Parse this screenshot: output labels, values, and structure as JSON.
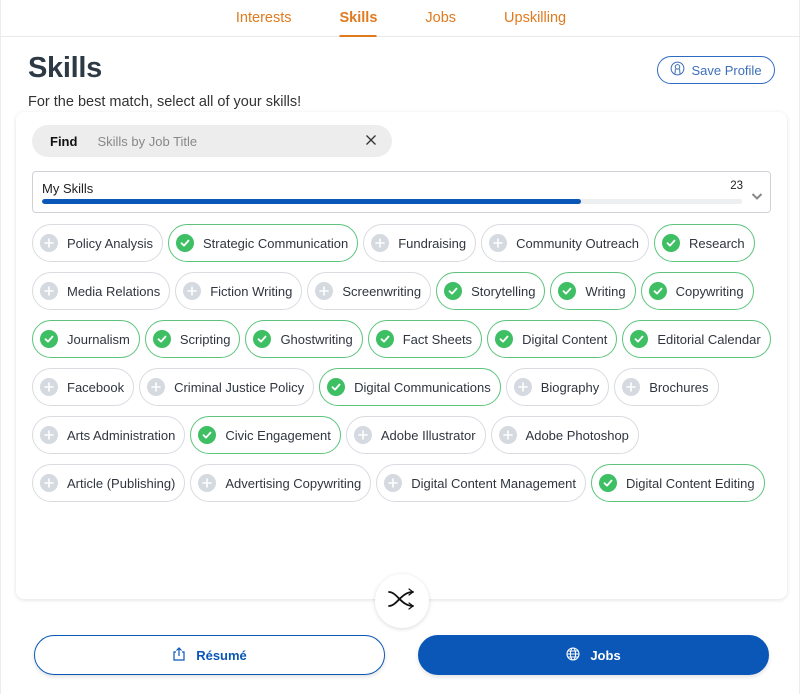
{
  "nav": {
    "tabs": [
      {
        "label": "Interests",
        "active": false
      },
      {
        "label": "Skills",
        "active": true
      },
      {
        "label": "Jobs",
        "active": false
      },
      {
        "label": "Upskilling",
        "active": false
      }
    ]
  },
  "header": {
    "title": "Skills",
    "subtitle": "For the best match, select all of your skills!",
    "save_label": "Save Profile"
  },
  "find": {
    "label": "Find",
    "placeholder": "Skills by Job Title",
    "value": ""
  },
  "my_skills": {
    "label": "My Skills",
    "count": "23",
    "progress_percent": 77
  },
  "skills": [
    {
      "label": "Policy Analysis",
      "selected": false
    },
    {
      "label": "Strategic Communication",
      "selected": true
    },
    {
      "label": "Fundraising",
      "selected": false
    },
    {
      "label": "Community Outreach",
      "selected": false
    },
    {
      "label": "Research",
      "selected": true
    },
    {
      "label": "Media Relations",
      "selected": false
    },
    {
      "label": "Fiction Writing",
      "selected": false
    },
    {
      "label": "Screenwriting",
      "selected": false
    },
    {
      "label": "Storytelling",
      "selected": true
    },
    {
      "label": "Writing",
      "selected": true
    },
    {
      "label": "Copywriting",
      "selected": true
    },
    {
      "label": "Journalism",
      "selected": true
    },
    {
      "label": "Scripting",
      "selected": true
    },
    {
      "label": "Ghostwriting",
      "selected": true
    },
    {
      "label": "Fact Sheets",
      "selected": true
    },
    {
      "label": "Digital Content",
      "selected": true
    },
    {
      "label": "Editorial Calendar",
      "selected": true
    },
    {
      "label": "Facebook",
      "selected": false
    },
    {
      "label": "Criminal Justice Policy",
      "selected": false
    },
    {
      "label": "Digital Communications",
      "selected": true
    },
    {
      "label": "Biography",
      "selected": false
    },
    {
      "label": "Brochures",
      "selected": false
    },
    {
      "label": "Arts Administration",
      "selected": false
    },
    {
      "label": "Civic Engagement",
      "selected": true
    },
    {
      "label": "Adobe Illustrator",
      "selected": false
    },
    {
      "label": "Adobe Photoshop",
      "selected": false
    },
    {
      "label": "Article (Publishing)",
      "selected": false
    },
    {
      "label": "Advertising Copywriting",
      "selected": false
    },
    {
      "label": "Digital Content Management",
      "selected": false
    },
    {
      "label": "Digital Content Editing",
      "selected": true
    }
  ],
  "icons": {
    "save": "user-circle-icon",
    "clear": "close-icon",
    "dropdown": "chevron-down-icon",
    "selected": "check-circle-icon",
    "unselected": "plus-circle-icon",
    "shuffle": "shuffle-icon",
    "resume": "upload-icon",
    "jobs": "globe-icon"
  },
  "footer": {
    "resume_label": "Résumé",
    "jobs_label": "Jobs"
  },
  "colors": {
    "accent_orange": "#e07a1f",
    "primary_blue": "#0a57b8",
    "selected_green": "#3fbf64",
    "unselected_gray": "#d5d9e0"
  }
}
